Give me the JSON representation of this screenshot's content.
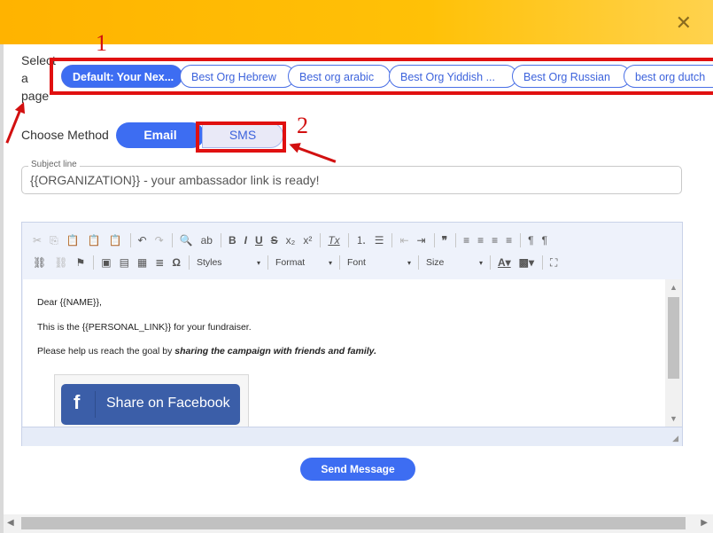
{
  "dialog": {
    "close_icon": "close-icon"
  },
  "select_page_label": {
    "line1": "Select",
    "line2": "a",
    "line3": "page"
  },
  "pages": [
    {
      "label": "Default: Your Nex...",
      "active": true
    },
    {
      "label": "Best Org Hebrew",
      "active": false
    },
    {
      "label": "Best org arabic",
      "active": false
    },
    {
      "label": "Best Org Yiddish ...",
      "active": false
    },
    {
      "label": "Best Org Russian",
      "active": false
    },
    {
      "label": "best org dutch",
      "active": false
    }
  ],
  "method": {
    "label": "Choose Method",
    "email": "Email",
    "sms": "SMS"
  },
  "subject": {
    "legend": "Subject line",
    "value": "{{ORGANIZATION}} - your ambassador link is ready!"
  },
  "annotations": {
    "one": "1",
    "two": "2",
    "color": "#d21010"
  },
  "toolbar": {
    "styles": "Styles",
    "format": "Format",
    "font": "Font",
    "size": "Size"
  },
  "editor": {
    "greeting": "Dear {{NAME}},",
    "line1": "This is the {{PERSONAL_LINK}} for your fundraiser.",
    "line2_plain": "Please help us reach the goal by ",
    "line2_emph": "sharing the campaign with friends and family.",
    "fb_button": "Share on Facebook"
  },
  "send_button": "Send Message",
  "colors": {
    "accent": "#3d6df2",
    "header": "#ffc107",
    "annotation": "#e01010",
    "facebook": "#3b5ea8"
  }
}
